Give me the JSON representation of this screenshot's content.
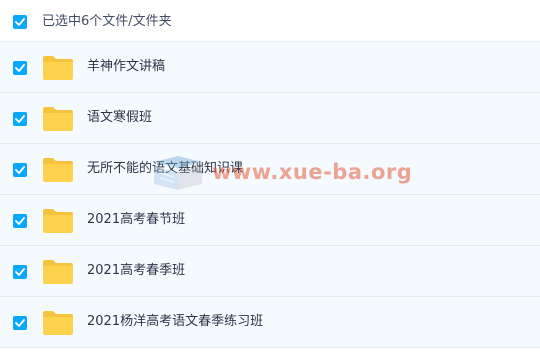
{
  "header": {
    "select_all_checked": true,
    "selection_text": "已选中6个文件/文件夹"
  },
  "files": [
    {
      "name": "羊神作文讲稿",
      "type": "folder",
      "checked": true
    },
    {
      "name": "语文寒假班",
      "type": "folder",
      "checked": true
    },
    {
      "name": "无所不能的语文基础知识课",
      "type": "folder",
      "checked": true
    },
    {
      "name": "2021高考春节班",
      "type": "folder",
      "checked": true
    },
    {
      "name": "2021高考春季班",
      "type": "folder",
      "checked": true
    },
    {
      "name": "2021杨洋高考语文春季练习班",
      "type": "folder",
      "checked": true
    }
  ],
  "watermark": {
    "text": "www.xue-ba.org"
  },
  "colors": {
    "checkbox": "#06a7ff",
    "folder": "#ffd24d",
    "row_background": "#f5fafe",
    "watermark": "#e25c3c"
  },
  "icons": {
    "checkbox": "checkbox-checked-icon",
    "folder": "folder-icon"
  }
}
